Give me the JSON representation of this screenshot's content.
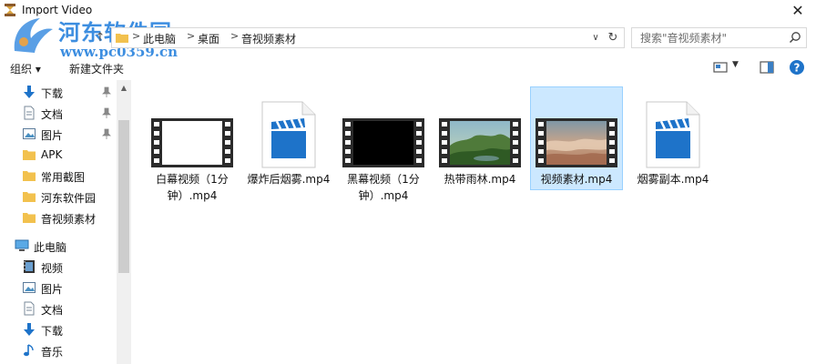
{
  "window": {
    "title": "Import Video"
  },
  "watermark": {
    "site_name": "河东软件园",
    "url": "www.pc0359.cn"
  },
  "address": {
    "crumbs": [
      "此电脑",
      "桌面",
      "音视频素材"
    ],
    "separator": ">",
    "dropdown": "∨",
    "refresh": "↻"
  },
  "search": {
    "placeholder": "搜索\"音视频素材\""
  },
  "toolbar": {
    "organize": "组织 ▾",
    "new_folder": "新建文件夹",
    "view_drop": "▼"
  },
  "sidebar": {
    "quick_access": [
      {
        "label": "下载",
        "icon": "download-arrow-icon",
        "pinned": true
      },
      {
        "label": "文档",
        "icon": "document-icon",
        "pinned": true
      },
      {
        "label": "图片",
        "icon": "picture-icon",
        "pinned": true
      },
      {
        "label": "APK",
        "icon": "folder-icon",
        "pinned": false
      },
      {
        "label": "常用截图",
        "icon": "folder-icon",
        "pinned": false
      },
      {
        "label": "河东软件园",
        "icon": "folder-icon",
        "pinned": false
      },
      {
        "label": "音视频素材",
        "icon": "folder-icon",
        "pinned": false
      }
    ],
    "this_pc": {
      "label": "此电脑",
      "icon": "computer-icon"
    },
    "this_pc_items": [
      {
        "label": "视频",
        "icon": "video-folder-icon"
      },
      {
        "label": "图片",
        "icon": "picture-icon"
      },
      {
        "label": "文档",
        "icon": "document-icon"
      },
      {
        "label": "下载",
        "icon": "download-arrow-icon"
      },
      {
        "label": "音乐",
        "icon": "music-note-icon"
      }
    ]
  },
  "files": [
    {
      "name": "白幕视频（1分钟）.mp4",
      "thumb": "film-white",
      "selected": false
    },
    {
      "name": "爆炸后烟雾.mp4",
      "thumb": "clapper",
      "selected": false
    },
    {
      "name": "黑幕视频（1分钟）.mp4",
      "thumb": "film-black",
      "selected": false
    },
    {
      "name": "热带雨林.mp4",
      "thumb": "film-forest",
      "selected": false
    },
    {
      "name": "视频素材.mp4",
      "thumb": "film-clouds",
      "selected": true
    },
    {
      "name": "烟雾副本.mp4",
      "thumb": "clapper",
      "selected": false
    }
  ],
  "colors": {
    "selection_bg": "#cce8ff",
    "selection_border": "#99d1ff",
    "watermark": "#3d8ee0",
    "folder": "#f2c14e",
    "clapper": "#1e73c9"
  }
}
